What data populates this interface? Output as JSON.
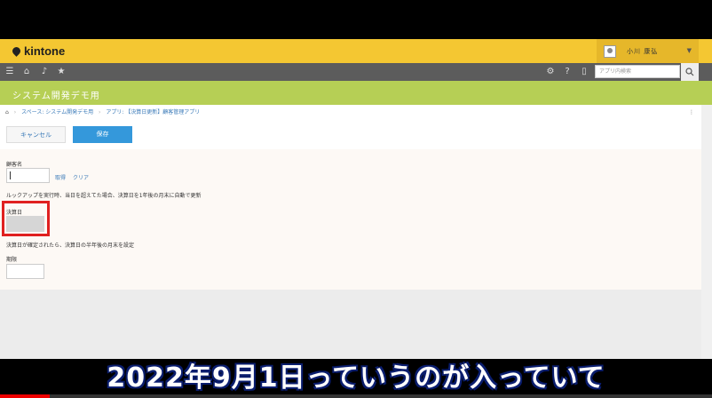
{
  "app": {
    "logo": "kintone",
    "user_name": "小川 康弘",
    "search_placeholder": "アプリ内検索",
    "space_title": "システム開発デモ用"
  },
  "breadcrumb": {
    "items": [
      "スペース: システム開発デモ用",
      "アプリ: 【決算日更新】顧客管理アプリ"
    ]
  },
  "form": {
    "cancel_label": "キャンセル",
    "save_label": "保存",
    "customer_label": "顧客名",
    "lookup_fetch": "取得",
    "lookup_clear": "クリア",
    "lookup_note": "ルックアップを実行時、当日を超えてた場合、決算日を1年後の月末に自動で更新",
    "closing_label": "決算日",
    "closing_note": "決算日が確定されたら、決算日の半年後の月末を設定",
    "term_label": "期限"
  },
  "video": {
    "subtitle": "2022年9月1日っていうのが入っていて",
    "progress": 0.07
  },
  "colors": {
    "header": "#f4c732",
    "nav": "#5c5c5c",
    "banner": "#b6cf55",
    "primary": "#3498db",
    "highlight": "#e02020"
  }
}
